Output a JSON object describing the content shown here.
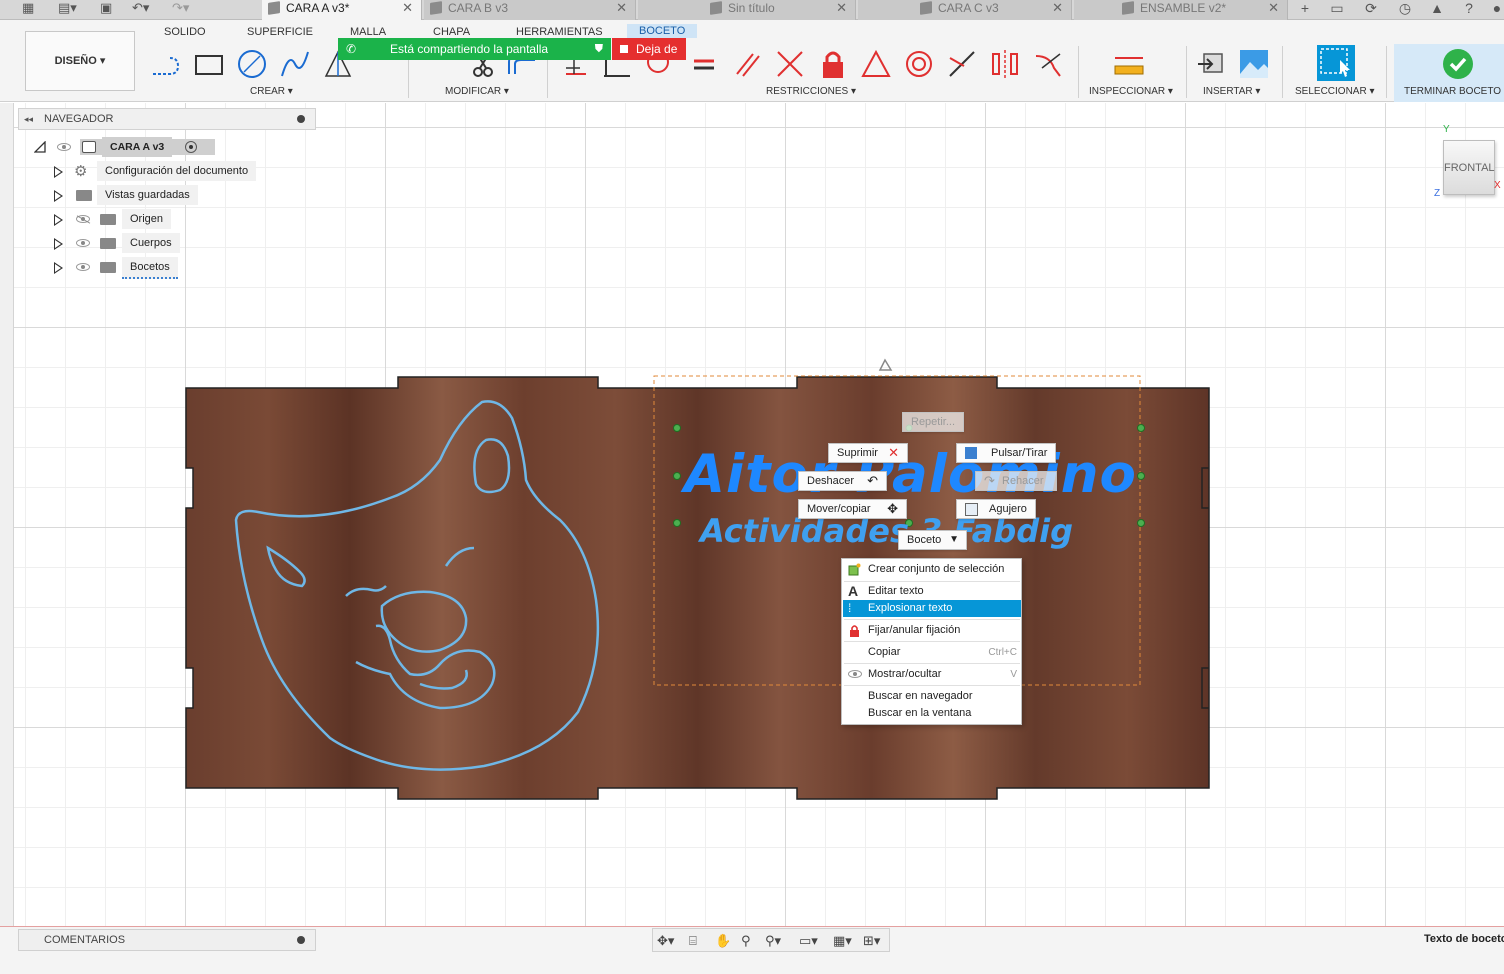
{
  "tabs": [
    {
      "label": "CARA A v3*",
      "active": true
    },
    {
      "label": "CARA B v3",
      "active": false
    },
    {
      "label": "Sin título",
      "active": false
    },
    {
      "label": "CARA C v3",
      "active": false
    },
    {
      "label": "ENSAMBLE v2*",
      "active": false
    }
  ],
  "ribbon": {
    "workspace": "DISEÑO",
    "tabs": [
      "SOLIDO",
      "SUPERFICIE",
      "MALLA",
      "CHAPA",
      "HERRAMIENTAS",
      "BOCETO"
    ],
    "groups": [
      "CREAR",
      "MODIFICAR",
      "RESTRICCIONES",
      "INSPECCIONAR",
      "INSERTAR",
      "SELECCIONAR",
      "TERMINAR BOCETO"
    ]
  },
  "share": {
    "message": "Está compartiendo la pantalla",
    "stop_label": "Deja de"
  },
  "browser": {
    "title": "NAVEGADOR",
    "root": "CARA A v3",
    "items": [
      "Configuración del documento",
      "Vistas guardadas",
      "Origen",
      "Cuerpos",
      "Bocetos"
    ]
  },
  "viewcube": {
    "face": "FRONTAL",
    "axes": {
      "y": "Y",
      "x": "X",
      "z": "Z"
    }
  },
  "canvas_text": {
    "line1": "Aitor Palomino",
    "line2": "Actividades 3 Fabdig"
  },
  "marking_menu": {
    "repeat": "Repetir...",
    "delete": "Suprimir",
    "press_pull": "Pulsar/Tirar",
    "undo": "Deshacer",
    "redo": "Rehacer",
    "move_copy": "Mover/copiar",
    "hole": "Agujero",
    "sketch": "Boceto"
  },
  "context_menu": {
    "items": [
      {
        "label": "Crear conjunto de selección",
        "shortcut": "",
        "highlight": false
      },
      {
        "label": "Editar texto",
        "shortcut": "",
        "highlight": false
      },
      {
        "label": "Explosionar texto",
        "shortcut": "",
        "highlight": true
      },
      {
        "label": "Fijar/anular fijación",
        "shortcut": "",
        "highlight": false
      },
      {
        "label": "Copiar",
        "shortcut": "Ctrl+C",
        "highlight": false
      },
      {
        "label": "Mostrar/ocultar",
        "shortcut": "V",
        "highlight": false
      },
      {
        "label": "Buscar en navegador",
        "shortcut": "",
        "highlight": false
      },
      {
        "label": "Buscar en la ventana",
        "shortcut": "",
        "highlight": false
      }
    ]
  },
  "comments": {
    "title": "COMENTARIOS"
  },
  "status": {
    "text": "Texto de boceto"
  },
  "colors": {
    "accent": "#0696d7",
    "share_green": "#1bb34a",
    "share_red": "#e52f2f",
    "sketch_text": "#1e88ff",
    "wood": "#6b3f2e",
    "profile_line": "#6fb7e6"
  }
}
